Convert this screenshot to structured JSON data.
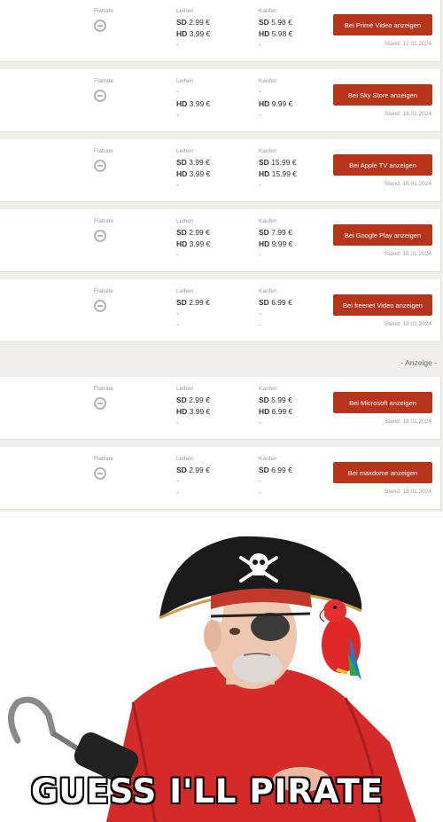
{
  "labels": {
    "flatrate": "Flatrate",
    "leihen": "Leihen",
    "kaufen": "Kaufen"
  },
  "offers": [
    {
      "rent_sd": "2.99 €",
      "rent_hd": "3.99 €",
      "buy_sd": "5.98 €",
      "buy_hd": "5.98 €",
      "button": "Bei Prime Video anzeigen",
      "stand": "Stand: 17.01.2024"
    },
    {
      "rent_sd": "-",
      "rent_hd": "3.99 €",
      "buy_sd": "-",
      "buy_hd": "9.99 €",
      "button": "Bei Sky Store anzeigen",
      "stand": "Stand: 18.01.2024"
    },
    {
      "rent_sd": "3.99 €",
      "rent_hd": "3.99 €",
      "buy_sd": "15.99 €",
      "buy_hd": "15.99 €",
      "button": "Bei Apple TV anzeigen",
      "stand": "Stand: 18.01.2024"
    },
    {
      "rent_sd": "2.99 €",
      "rent_hd": "3.99 €",
      "buy_sd": "7.99 €",
      "buy_hd": "9.99 €",
      "button": "Bei Google Play anzeigen",
      "stand": "Stand: 18.01.2024"
    },
    {
      "rent_sd": "2.99 €",
      "rent_hd": "-",
      "buy_sd": "6.99 €",
      "buy_hd": "-",
      "button": "Bei freenet Video anzeigen",
      "stand": "Stand: 18.01.2024"
    },
    {
      "rent_sd": "2.99 €",
      "rent_hd": "3.99 €",
      "buy_sd": "5.99 €",
      "buy_hd": "6.99 €",
      "button": "Bei Microsoft anzeigen",
      "stand": "Stand: 18.01.2024"
    },
    {
      "rent_sd": "2.99 €",
      "rent_hd": "-",
      "buy_sd": "6.99 €",
      "buy_hd": "-",
      "button": "Bei maxdome anzeigen",
      "stand": "Stand: 18.01.2024"
    }
  ],
  "sd_label": "SD",
  "hd_label": "HD",
  "empty_mark": "-",
  "ad_label": "- Anzeige -",
  "meme": {
    "caption": "GUESS I'LL PIRATE"
  },
  "colors": {
    "button": "#b5341a",
    "page_bg": "#f1efeb",
    "shirt": "#d42a2a",
    "hat": "#1a1a1a"
  }
}
